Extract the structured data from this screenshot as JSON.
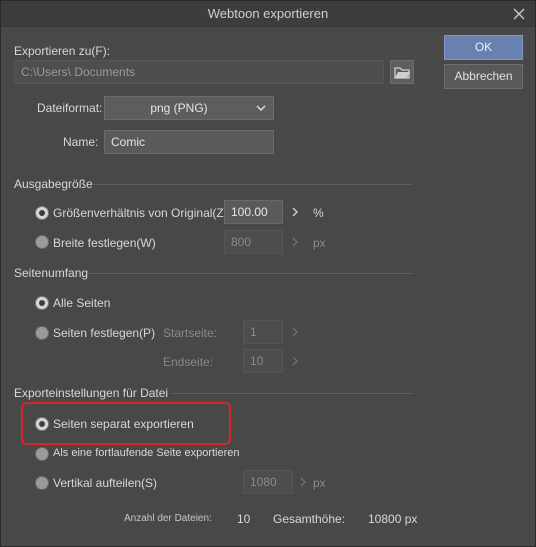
{
  "window": {
    "title": "Webtoon exportieren",
    "close_icon": "close-icon"
  },
  "export_to": {
    "label": "Exportieren zu(F):",
    "path": "C:\\Users\\          Documents",
    "folder_icon": "folder-open-icon"
  },
  "file_format": {
    "label": "Dateiformat:",
    "value": "png (PNG)"
  },
  "name": {
    "label": "Name:",
    "value": "Comic"
  },
  "buttons": {
    "ok": "OK",
    "cancel": "Abbrechen"
  },
  "output_size": {
    "title": "Ausgabegröße",
    "ratio_label": "Größenverhältnis von Original(Z)",
    "ratio_value": "100.00",
    "ratio_unit": "%",
    "width_label": "Breite festlegen(W)",
    "width_value": "800",
    "width_unit": "px"
  },
  "page_range": {
    "title": "Seitenumfang",
    "all_label": "Alle Seiten",
    "specify_label": "Seiten festlegen(P)",
    "start_label": "Startseite:",
    "start_value": "1",
    "end_label": "Endseite:",
    "end_value": "10"
  },
  "file_settings": {
    "title": "Exporteinstellungen für Datei",
    "separate_label": "Seiten separat exportieren",
    "continuous_label": "Als eine fortlaufende Seite exportieren",
    "split_label": "Vertikal aufteilen(S)",
    "split_value": "1080",
    "split_unit": "px"
  },
  "summary": {
    "count_label": "Anzahl der Dateien:",
    "count_value": "10",
    "height_label": "Gesamthöhe:",
    "height_value": "10800 px"
  },
  "colors": {
    "highlight": "#d8242a",
    "primary_button": "#6a80b0"
  }
}
